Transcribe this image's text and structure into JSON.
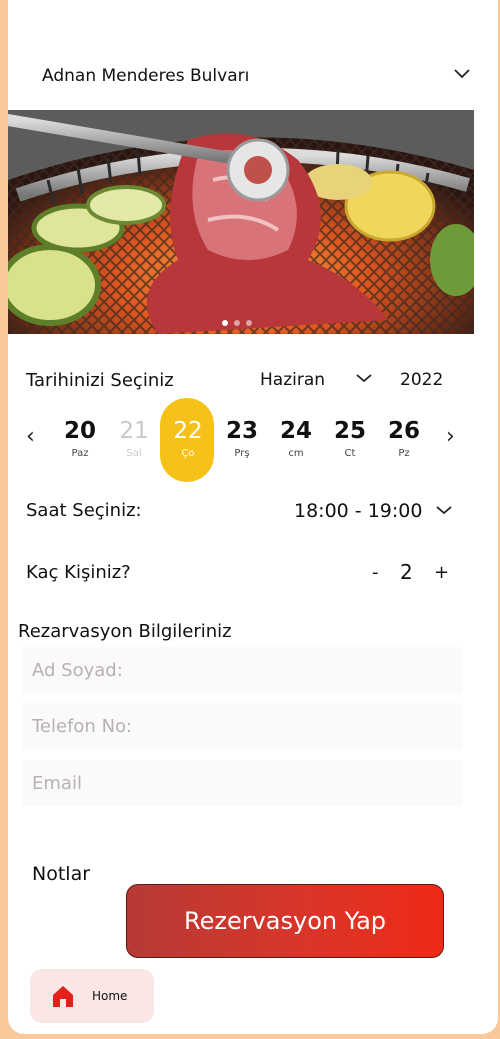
{
  "location": {
    "name": "Adnan Menderes Bulvarı"
  },
  "date": {
    "label": "Tarihinizi Seçiniz",
    "month": "Haziran",
    "year": "2022",
    "prev_arrow": "‹",
    "next_arrow": "›",
    "days": [
      {
        "num": "20",
        "name": "Paz",
        "state": "normal"
      },
      {
        "num": "21",
        "name": "Sal",
        "state": "disabled"
      },
      {
        "num": "22",
        "name": "Ço",
        "state": "selected"
      },
      {
        "num": "23",
        "name": "Prş",
        "state": "normal"
      },
      {
        "num": "24",
        "name": "cm",
        "state": "normal"
      },
      {
        "num": "25",
        "name": "Ct",
        "state": "normal"
      },
      {
        "num": "26",
        "name": "Pz",
        "state": "normal"
      }
    ]
  },
  "time": {
    "label": "Saat Seçiniz:",
    "value": "18:00 - 19:00"
  },
  "people": {
    "label": "Kaç Kişiniz?",
    "minus": "-",
    "count": "2",
    "plus": "+"
  },
  "reservation": {
    "title": "Rezarvasyon Bilgileriniz",
    "name_placeholder": "Ad Soyad:",
    "phone_placeholder": "Telefon No:",
    "email_placeholder": "Email"
  },
  "notes": {
    "label": "Notlar"
  },
  "cta": {
    "label": "Rezervasyon Yap"
  },
  "nav": {
    "home_label": "Home"
  },
  "colors": {
    "page_bg": "#f9c89b",
    "selected_day": "#f6c21a",
    "cta_start": "#b63a35",
    "cta_end": "#ef2a16",
    "home_tab_bg": "#fbe6e6",
    "home_icon": "#e32119"
  }
}
